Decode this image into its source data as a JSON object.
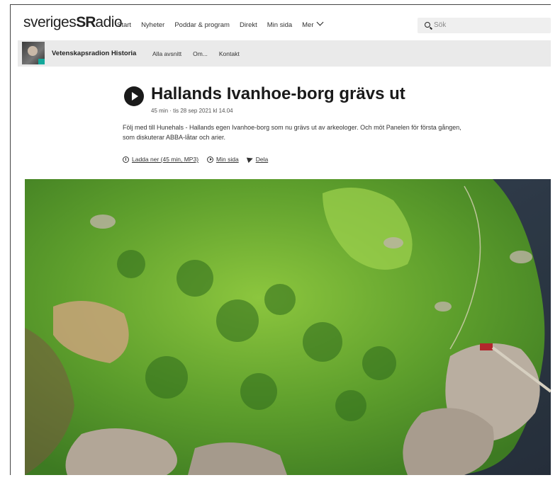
{
  "header": {
    "logo_text_left": "sveriges",
    "logo_text_mid": "SR",
    "logo_text_right": "adio",
    "nav": [
      "Start",
      "Nyheter",
      "Poddar & program",
      "Direkt",
      "Min sida",
      "Mer"
    ],
    "search_placeholder": "Sök"
  },
  "subnav": {
    "program_title": "Vetenskapsradion Historia",
    "links": [
      "Alla avsnitt",
      "Om...",
      "Kontakt"
    ]
  },
  "episode": {
    "title": "Hallands Ivanhoe-borg grävs ut",
    "meta": "45 min  ·  tis 28 sep 2021 kl 14.04",
    "description": "Följ med till Hunehals - Hallands egen Ivanhoe-borg som nu grävs ut av arkeologer. Och möt Panelen för första gången, som diskuterar ABBA-låtar och arier.",
    "actions": {
      "download": "Ladda ner (45 min, MP3)",
      "my_page": "Min sida",
      "share": "Dela"
    }
  },
  "colors": {
    "subnav_bg": "#eaeaea",
    "accent_teal": "#14a89b",
    "grass": "#5d9e2c",
    "water": "#24334a"
  },
  "icons": [
    "search-icon",
    "chevron-down-icon",
    "play-icon",
    "download-icon",
    "play-small-icon",
    "share-icon"
  ]
}
